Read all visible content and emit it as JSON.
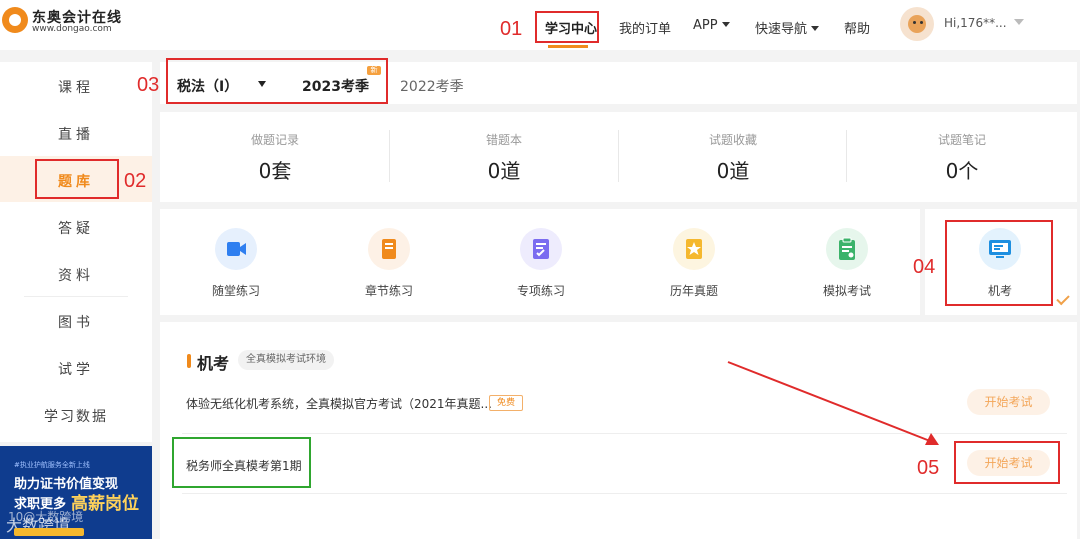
{
  "header": {
    "logo_name": "东奥会计在线",
    "logo_url": "www.dongao.com",
    "nav": {
      "study_center": "学习中心",
      "my_orders": "我的订单",
      "app": "APP",
      "quick_nav": "快速导航",
      "help": "帮助"
    },
    "user_name": "Hi,176**..."
  },
  "sidebar": {
    "items": [
      "课程",
      "直播",
      "题库",
      "答疑",
      "资料",
      "图书",
      "试学",
      "学习数据"
    ],
    "active": "题库"
  },
  "banner": {
    "small": "#执业护航服务全新上线",
    "line1": "助力证书价值变现",
    "line2a": "求职更多",
    "line2b": "高薪岗位",
    "line3": "大数跨境"
  },
  "season": {
    "subject": "税法（I）",
    "current": "2023考季",
    "badge": "新",
    "previous": "2022考季"
  },
  "stats": [
    {
      "label": "做题记录",
      "value": "0套"
    },
    {
      "label": "错题本",
      "value": "0道"
    },
    {
      "label": "试题收藏",
      "value": "0道"
    },
    {
      "label": "试题笔记",
      "value": "0个"
    }
  ],
  "practice": [
    {
      "label": "随堂练习",
      "icon": "video-icon",
      "color": "#2f7ff0",
      "bg": "#e6f0fd"
    },
    {
      "label": "章节练习",
      "icon": "book-icon",
      "color": "#f08a1c",
      "bg": "#fdf1e6"
    },
    {
      "label": "专项练习",
      "icon": "checklist-icon",
      "color": "#7b6cf0",
      "bg": "#eeecfd"
    },
    {
      "label": "历年真题",
      "icon": "star-icon",
      "color": "#f5b82e",
      "bg": "#fdf5e0"
    },
    {
      "label": "模拟考试",
      "icon": "clipboard-icon",
      "color": "#3bb36a",
      "bg": "#e6f6ec"
    }
  ],
  "jikao": {
    "label": "机考",
    "icon": "monitor-icon",
    "color": "#1e8fe0",
    "bg": "#e3f2fd"
  },
  "exam": {
    "title": "机考",
    "tag": "全真模拟考试环境",
    "rows": [
      {
        "text": "体验无纸化机考系统，全真模拟官方考试（2021年真题...",
        "free": "免费",
        "button": "开始考试"
      },
      {
        "text": "税务师全真模考第1期",
        "button": "开始考试"
      }
    ]
  },
  "annotations": [
    "01",
    "02",
    "03",
    "04",
    "05"
  ],
  "watermark": "10@大数跨境"
}
